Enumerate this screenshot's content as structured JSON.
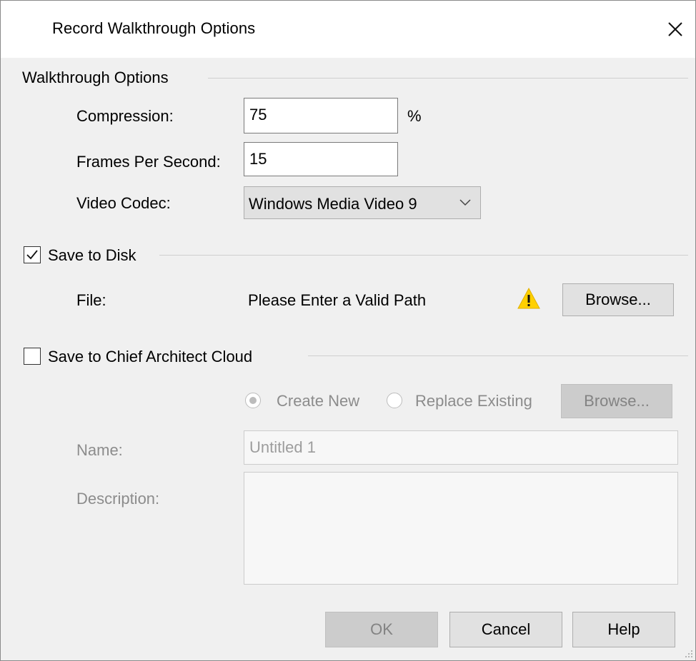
{
  "window": {
    "title": "Record Walkthrough Options",
    "close_icon": "close-icon"
  },
  "walkthrough": {
    "group_title": "Walkthrough Options",
    "compression_label": "Compression:",
    "compression_value": "75",
    "compression_unit": "%",
    "fps_label": "Frames Per Second:",
    "fps_value": "15",
    "codec_label": "Video Codec:",
    "codec_value": "Windows Media Video 9"
  },
  "save_to_disk": {
    "label": "Save to Disk",
    "checked": true,
    "file_label": "File:",
    "file_value": "Please Enter a Valid Path",
    "warning_icon": "warning-icon",
    "browse_label": "Browse..."
  },
  "cloud": {
    "label": "Save to Chief Architect Cloud",
    "checked": false,
    "create_new_label": "Create New",
    "replace_existing_label": "Replace Existing",
    "browse_label": "Browse...",
    "name_label": "Name:",
    "name_value": "Untitled 1",
    "description_label": "Description:",
    "description_value": ""
  },
  "footer": {
    "ok_label": "OK",
    "cancel_label": "Cancel",
    "help_label": "Help"
  },
  "colors": {
    "warning": "#ffd000",
    "disabled_text": "#8c8c8c"
  }
}
